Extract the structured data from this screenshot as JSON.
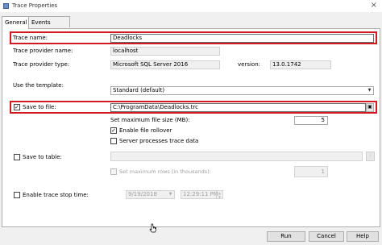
{
  "window": {
    "title": "Trace Properties",
    "close_glyph": "×"
  },
  "tabs": [
    {
      "label": "General",
      "active": true
    },
    {
      "label": "Events Selection",
      "active": false
    }
  ],
  "general": {
    "trace_name": {
      "label": "Trace name:",
      "value": "Deadlocks"
    },
    "provider_name": {
      "label": "Trace provider name:",
      "value": "localhost"
    },
    "provider_type": {
      "label": "Trace provider type:",
      "value": "Microsoft SQL Server 2016",
      "version_label": "version:",
      "version_value": "13.0.1742"
    },
    "template": {
      "label": "Use the template:",
      "value": "Standard (default)"
    },
    "save_to_file": {
      "label": "Save to file:",
      "checked": true,
      "value": "C:\\ProgramData\\Deadlocks.trc"
    },
    "max_file_size": {
      "label": "Set maximum file size (MB):",
      "value": "5"
    },
    "file_rollover": {
      "label": "Enable file rollover",
      "checked": true
    },
    "server_processes": {
      "label": "Server processes trace data",
      "checked": false
    },
    "save_to_table": {
      "label": "Save to table:",
      "checked": false
    },
    "max_rows": {
      "label": "Set maximum rows (in thousands):",
      "value": "1",
      "checked": false
    },
    "stop_time": {
      "label": "Enable trace stop time:",
      "checked": false,
      "date": "9/19/2018",
      "time": "12:29:11 PM"
    }
  },
  "footer": {
    "run_label": "Run",
    "cancel_label": "Cancel",
    "help_label": "Help"
  },
  "colors": {
    "highlight": "#d1191f",
    "panel_bg": "#ffffff",
    "window_bg": "#f0f0f0"
  },
  "icons": [
    "app-icon",
    "close-icon",
    "folder-icon",
    "browse-icon",
    "dropdown-arrow-icon",
    "spinner-icon",
    "calendar-icon",
    "mouse-cursor-icon"
  ]
}
